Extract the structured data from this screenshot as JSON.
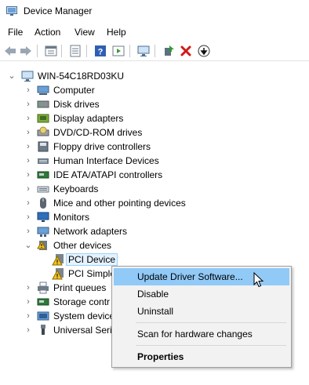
{
  "window": {
    "title": "Device Manager"
  },
  "menu": {
    "items": [
      "File",
      "Action",
      "View",
      "Help"
    ]
  },
  "toolbar": {
    "buttons": [
      "back-icon",
      "forward-icon",
      "properties-view-icon",
      "list-view-icon",
      "help-icon",
      "run-icon",
      "monitor-scan-icon",
      "enable-device-icon",
      "uninstall-icon",
      "update-driver-icon"
    ]
  },
  "tree": {
    "root": "WIN-54C18RD03KU",
    "categories": [
      {
        "label": "Computer",
        "icon": "computer-icon"
      },
      {
        "label": "Disk drives",
        "icon": "disk-drive-icon"
      },
      {
        "label": "Display adapters",
        "icon": "display-adapter-icon"
      },
      {
        "label": "DVD/CD-ROM drives",
        "icon": "dvd-drive-icon"
      },
      {
        "label": "Floppy drive controllers",
        "icon": "floppy-controller-icon"
      },
      {
        "label": "Human Interface Devices",
        "icon": "hid-icon"
      },
      {
        "label": "IDE ATA/ATAPI controllers",
        "icon": "ide-controller-icon"
      },
      {
        "label": "Keyboards",
        "icon": "keyboard-icon"
      },
      {
        "label": "Mice and other pointing devices",
        "icon": "mouse-icon"
      },
      {
        "label": "Monitors",
        "icon": "monitor-icon"
      },
      {
        "label": "Network adapters",
        "icon": "network-adapter-icon"
      },
      {
        "label": "Other devices",
        "icon": "other-devices-icon"
      },
      {
        "label": "PCI Device",
        "icon": "warning-device-icon"
      },
      {
        "label": "PCI Simple",
        "icon": "warning-device-icon"
      },
      {
        "label": "Print queues",
        "icon": "printer-icon"
      },
      {
        "label": "Storage contr",
        "icon": "storage-controller-icon"
      },
      {
        "label": "System device",
        "icon": "system-device-icon"
      },
      {
        "label": "Universal Seria",
        "icon": "usb-icon"
      }
    ]
  },
  "context_menu": {
    "items": [
      "Update Driver Software...",
      "Disable",
      "Uninstall",
      "Scan for hardware changes",
      "Properties"
    ]
  },
  "colors": {
    "selection": "#e5f3ff",
    "selection_border": "#99d1ff",
    "menu_highlight": "#91c9f7",
    "menu_bg": "#f2f2f2"
  }
}
